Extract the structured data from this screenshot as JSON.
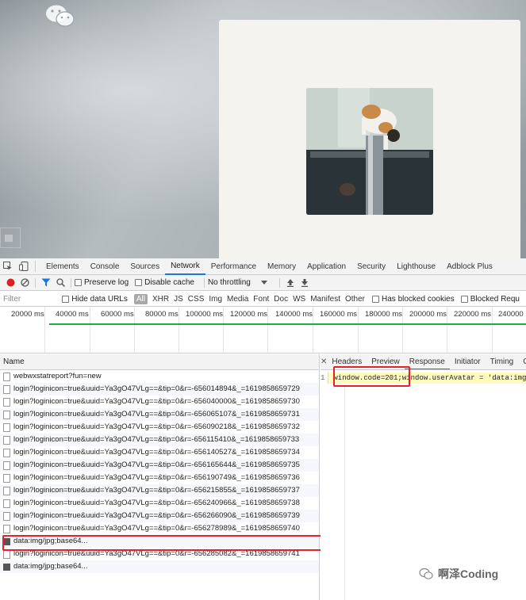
{
  "devtools_tabs": [
    "Elements",
    "Console",
    "Sources",
    "Network",
    "Performance",
    "Memory",
    "Application",
    "Security",
    "Lighthouse",
    "Adblock Plus"
  ],
  "active_tab": "Network",
  "toolbar": {
    "preserve_log": "Preserve log",
    "disable_cache": "Disable cache",
    "throttling": "No throttling"
  },
  "filter": {
    "placeholder": "Filter",
    "hide_data_urls": "Hide data URLs",
    "types": [
      "All",
      "XHR",
      "JS",
      "CSS",
      "Img",
      "Media",
      "Font",
      "Doc",
      "WS",
      "Manifest",
      "Other"
    ],
    "has_blocked_cookies": "Has blocked cookies",
    "blocked_requests": "Blocked Requ"
  },
  "timeline_ticks": [
    "20000 ms",
    "40000 ms",
    "60000 ms",
    "80000 ms",
    "100000 ms",
    "120000 ms",
    "140000 ms",
    "160000 ms",
    "180000 ms",
    "200000 ms",
    "220000 ms",
    "240000 m"
  ],
  "table": {
    "header": "Name",
    "rows": [
      {
        "name": "webwxstatreport?fun=new",
        "type": "doc"
      },
      {
        "name": "login?loginicon=true&uuid=Ya3gO47VLg==&tip=0&r=-656014894&_=1619858659729",
        "type": "doc"
      },
      {
        "name": "login?loginicon=true&uuid=Ya3gO47VLg==&tip=0&r=-656040000&_=1619858659730",
        "type": "doc"
      },
      {
        "name": "login?loginicon=true&uuid=Ya3gO47VLg==&tip=0&r=-656065107&_=1619858659731",
        "type": "doc"
      },
      {
        "name": "login?loginicon=true&uuid=Ya3gO47VLg==&tip=0&r=-656090218&_=1619858659732",
        "type": "doc"
      },
      {
        "name": "login?loginicon=true&uuid=Ya3gO47VLg==&tip=0&r=-656115410&_=1619858659733",
        "type": "doc"
      },
      {
        "name": "login?loginicon=true&uuid=Ya3gO47VLg==&tip=0&r=-656140527&_=1619858659734",
        "type": "doc"
      },
      {
        "name": "login?loginicon=true&uuid=Ya3gO47VLg==&tip=0&r=-656165644&_=1619858659735",
        "type": "doc"
      },
      {
        "name": "login?loginicon=true&uuid=Ya3gO47VLg==&tip=0&r=-656190749&_=1619858659736",
        "type": "doc"
      },
      {
        "name": "login?loginicon=true&uuid=Ya3gO47VLg==&tip=0&r=-656215855&_=1619858659737",
        "type": "doc"
      },
      {
        "name": "login?loginicon=true&uuid=Ya3gO47VLg==&tip=0&r=-656240966&_=1619858659738",
        "type": "doc"
      },
      {
        "name": "login?loginicon=true&uuid=Ya3gO47VLg==&tip=0&r=-656266090&_=1619858659739",
        "type": "doc"
      },
      {
        "name": "login?loginicon=true&uuid=Ya3gO47VLg==&tip=0&r=-656278989&_=1619858659740",
        "type": "doc"
      },
      {
        "name": "data:img/jpg;base64...",
        "type": "img"
      },
      {
        "name": "login?loginicon=true&uuid=Ya3gO47VLg==&tip=0&r=-656285082&_=1619858659741",
        "type": "doc"
      },
      {
        "name": "data:img/jpg;base64...",
        "type": "img"
      }
    ]
  },
  "response_panel": {
    "tabs": [
      "Headers",
      "Preview",
      "Response",
      "Initiator",
      "Timing",
      "C"
    ],
    "active": "Response",
    "line_number": "1",
    "code": "window.code=201;window.userAvatar = 'data:img/"
  },
  "watermark": "啊泽Coding"
}
